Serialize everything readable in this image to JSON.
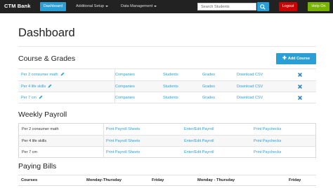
{
  "navbar": {
    "brand": "CTM Bank",
    "dashboard": "Dashboard",
    "additional_setup": "Additional Setup",
    "data_management": "Data Management",
    "search_placeholder": "Search Students",
    "logout": "Logout",
    "help": "Help On"
  },
  "page": {
    "title": "Dashboard"
  },
  "courses": {
    "title": "Course & Grades",
    "add_label": "Add Course",
    "rows": [
      {
        "name": "Per 2 consumer math",
        "companies": "Companies",
        "students": "Students",
        "grades": "Grades",
        "download": "Download CSV"
      },
      {
        "name": "Per 4 life skills",
        "companies": "Companies",
        "students": "Students",
        "grades": "Grades",
        "download": "Download CSV"
      },
      {
        "name": "Per 7 cm",
        "companies": "Companies",
        "students": "Students",
        "grades": "Grades",
        "download": "Download CSV"
      }
    ]
  },
  "payroll": {
    "title": "Weekly Payroll",
    "rows": [
      {
        "name": "Per 2 consumer math",
        "print_sheets": "Print Payroll Sheets",
        "enter_edit": "Enter/Edit Payroll",
        "print_paychecks": "Print Paychecks"
      },
      {
        "name": "Per 4 life skills",
        "print_sheets": "Print Payroll Sheets",
        "enter_edit": "Enter/Edit Payroll",
        "print_paychecks": "Print Paychecks"
      },
      {
        "name": "Per 7 cm",
        "print_sheets": "Print Payroll Sheets",
        "enter_edit": "Enter/Edit Payroll",
        "print_paychecks": "Print Paychecks"
      }
    ]
  },
  "bills": {
    "title": "Paying Bills",
    "headers": [
      "Courses",
      "Monday-Thursday",
      "Friday",
      "Monday - Thursday",
      "Friday"
    ]
  },
  "colors": {
    "primary": "#2a9fd6",
    "danger": "#cc0000",
    "success": "#77b300",
    "navbar": "#222222"
  },
  "icons": {
    "edit": "pencil-icon",
    "remove": "remove-x-icon",
    "search": "search-icon",
    "add": "plus-icon",
    "menu_caret": "caret-down-icon"
  }
}
